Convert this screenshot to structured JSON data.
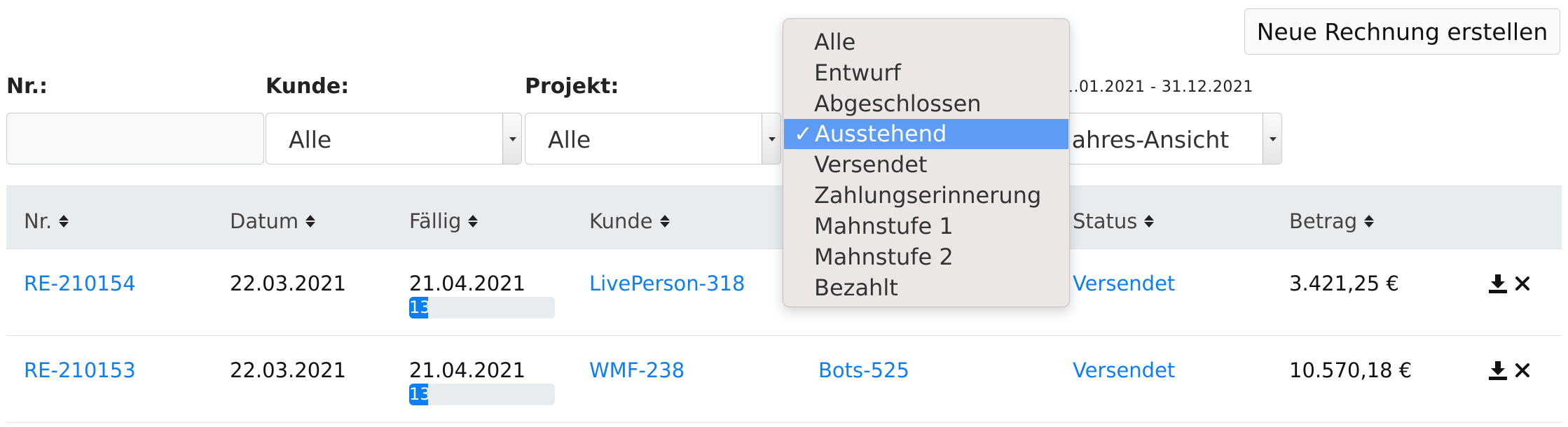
{
  "header": {
    "new_invoice_label": "Neue Rechnung erstellen"
  },
  "filters": {
    "nr_label": "Nr.:",
    "nr_value": "",
    "kunde_label": "Kunde:",
    "kunde_value": "Alle",
    "projekt_label": "Projekt:",
    "projekt_value": "Alle",
    "date_range": "1.01.2021 - 31.12.2021",
    "view_value": "Jahres-Ansicht"
  },
  "status_dropdown": {
    "options": [
      "Alle",
      "Entwurf",
      "Abgeschlossen",
      "Ausstehend",
      "Versendet",
      "Zahlungserinnerung",
      "Mahnstufe 1",
      "Mahnstufe 2",
      "Bezahlt"
    ],
    "selected": "Ausstehend",
    "checkmark": "✓"
  },
  "table": {
    "headers": [
      "Nr.",
      "Datum",
      "Fällig",
      "Kunde",
      "Status",
      "Betrag"
    ],
    "rows": [
      {
        "nr": "RE-210154",
        "datum": "22.03.2021",
        "faellig": "21.04.2021",
        "progress": "13",
        "progress_fraction": 0.13,
        "kunde": "LivePerson-318",
        "projekt": "",
        "status": "Versendet",
        "betrag": "3.421,25 €"
      },
      {
        "nr": "RE-210153",
        "datum": "22.03.2021",
        "faellig": "21.04.2021",
        "progress": "13",
        "progress_fraction": 0.13,
        "kunde": "WMF-238",
        "projekt": "Bots-525",
        "status": "Versendet",
        "betrag": "10.570,18 €"
      }
    ]
  },
  "icons": {
    "download": "download-icon",
    "delete": "close-icon"
  },
  "colors": {
    "link": "#0d7ff2",
    "selected_option": "#5e9bf5",
    "header_bg": "#e9ecef"
  }
}
